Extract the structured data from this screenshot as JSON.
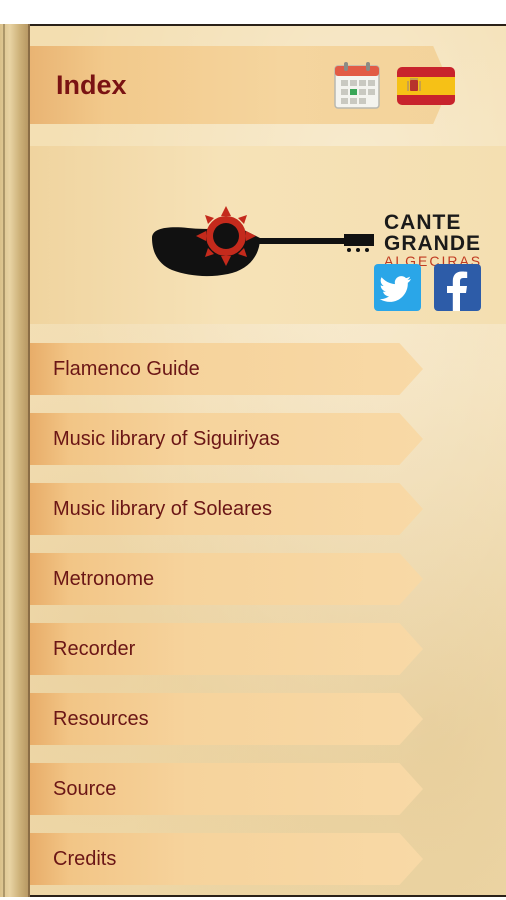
{
  "header": {
    "title": "Index",
    "calendar_icon": "calendar-icon",
    "language_icon": "spain-flag-icon"
  },
  "logo": {
    "line1": "CANTE",
    "line2": "GRANDE",
    "line3": "ALGECIRAS"
  },
  "social": {
    "twitter_icon": "twitter-icon",
    "facebook_icon": "facebook-icon",
    "twitter_color": "#2aa6e8",
    "facebook_color": "#2d5ca8"
  },
  "menu": [
    {
      "label": "Flamenco Guide"
    },
    {
      "label": "Music library of Siguiriyas"
    },
    {
      "label": "Music library of Soleares"
    },
    {
      "label": "Metronome"
    },
    {
      "label": "Recorder"
    },
    {
      "label": "Resources"
    },
    {
      "label": "Source"
    },
    {
      "label": "Credits"
    }
  ],
  "colors": {
    "title_text": "#7a1313",
    "menu_text": "#6b1616",
    "ribbon": "#f2c98b"
  }
}
